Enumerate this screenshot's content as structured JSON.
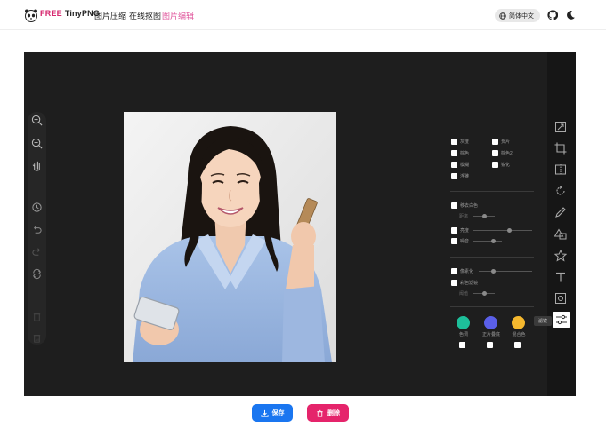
{
  "header": {
    "brand_free": "FREE",
    "brand_name": "TinyPNG",
    "nav": [
      {
        "label": "图片压缩",
        "active": false
      },
      {
        "label": "在线抠图",
        "active": false
      },
      {
        "label": "图片编辑",
        "active": true
      }
    ],
    "language_label": "简体中文"
  },
  "left_tools": [
    "zoom-in",
    "zoom-out",
    "pan-hand",
    "history",
    "undo",
    "redo",
    "reset",
    "delete",
    "delete-all"
  ],
  "right_tools": [
    "resize",
    "crop",
    "flip",
    "rotate",
    "draw",
    "shape",
    "icon",
    "text",
    "mask",
    "filter"
  ],
  "filter_tooltip": "滤镜",
  "filters": {
    "row1": [
      {
        "label": "灰度"
      },
      {
        "label": "负片"
      }
    ],
    "row2": [
      {
        "label": "棕色"
      },
      {
        "label": "棕色2"
      }
    ],
    "row3": [
      {
        "label": "模糊"
      },
      {
        "label": "锐化"
      }
    ],
    "row4": [
      {
        "label": "浮雕"
      }
    ],
    "remove_white": "移去白色",
    "distance": "距离",
    "brightness": "亮度",
    "noise": "噪音",
    "pixelate": "像素化",
    "color_filter": "彩色滤镜",
    "threshold": "阈值",
    "colors": [
      {
        "label": "色调",
        "color": "#1dbf9a"
      },
      {
        "label": "正片叠底",
        "color": "#5a5fe8"
      },
      {
        "label": "混合色",
        "color": "#f5b82e"
      }
    ]
  },
  "actions": {
    "save": "保存",
    "delete": "删除"
  }
}
